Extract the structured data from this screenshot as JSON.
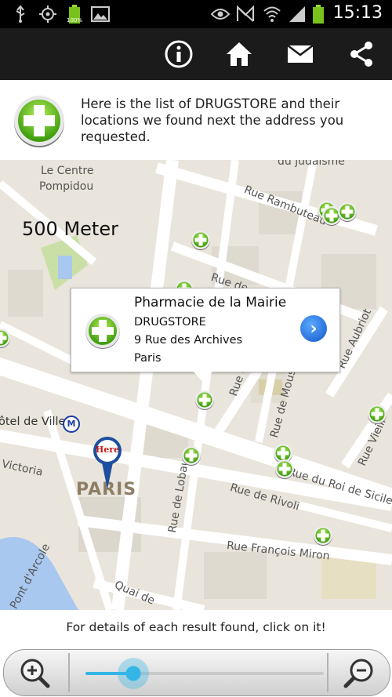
{
  "status_bar": {
    "battery_percent_label": "100%",
    "time": "15:13",
    "icons": [
      "usb-icon",
      "gps-icon",
      "battery-icon",
      "image-icon",
      "eye-icon",
      "nfc-icon",
      "wifi-icon",
      "signal-icon",
      "battery-icon"
    ]
  },
  "action_bar": {
    "buttons": [
      "info-icon",
      "home-icon",
      "mail-icon",
      "share-icon"
    ]
  },
  "header": {
    "text": "Here is the list of DRUGSTORE and their locations we found next the address you requested."
  },
  "map": {
    "scale_label": "500 Meter",
    "labels": {
      "centre": "Le Centre",
      "pompidou": "Pompidou",
      "rambuteau": "Rue Rambuteau",
      "judaisme": "du judaïsme",
      "aubriot": "Rue Aubriot",
      "moussy": "Rue de Moussy",
      "hotel_de_ville": "ôtel de Ville",
      "metro": "M",
      "victoria": "Victoria",
      "lobau": "Rue de Lobau",
      "rivoli": "Rue de Rivoli",
      "roi_sicile": "Rue du Roi de Sicile",
      "vieille": "Rue Vieill",
      "francois_miron": "Rue François Miron",
      "pont_arcole": "Pont d'Arcole",
      "quai": "Quai de",
      "rue_d": "Rue d",
      "rue_de": "Rue de",
      "paris": "PARIS",
      "here": "Here"
    },
    "callout": {
      "name": "Pharmacie de la Mairie",
      "category": "DRUGSTORE",
      "address": "9 Rue des Archives",
      "city": "Paris"
    }
  },
  "hint": "For details of each result found, click on it!",
  "zoom": {
    "level": 0.2,
    "zoom_in": "zoom-in-icon",
    "zoom_out": "zoom-out-icon"
  },
  "colors": {
    "accent": "#33b5e5",
    "pharmacy_green": "#5fbf1e",
    "map_bg": "#e9e5dc",
    "road": "#ffffff",
    "water": "#a9c8f0",
    "park": "#c9dfa6"
  }
}
